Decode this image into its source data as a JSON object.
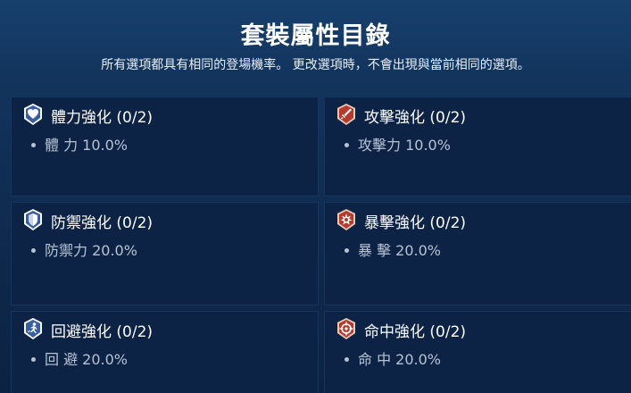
{
  "header": {
    "title": "套裝屬性目錄",
    "subtitle": "所有選項都具有相同的登場機率。 更改選項時，不會出現與當前相同的選項。"
  },
  "cards": [
    {
      "name": "體力強化 (0/2)",
      "stat": "體 力 10.0%",
      "icon": "heart-icon",
      "color": "#3a5f9e"
    },
    {
      "name": "攻擊強化 (0/2)",
      "stat": "攻擊力 10.0%",
      "icon": "sword-icon",
      "color": "#b23a2e"
    },
    {
      "name": "防禦強化 (0/2)",
      "stat": "防禦力 20.0%",
      "icon": "shield-icon",
      "color": "#3a5f9e"
    },
    {
      "name": "暴擊強化 (0/2)",
      "stat": "暴 擊 20.0%",
      "icon": "burst-icon",
      "color": "#b23a2e"
    },
    {
      "name": "回避強化 (0/2)",
      "stat": "回 避 20.0%",
      "icon": "dodge-icon",
      "color": "#3a5f9e"
    },
    {
      "name": "命中強化 (0/2)",
      "stat": "命 中 20.0%",
      "icon": "crosshair-icon",
      "color": "#b23a2e"
    }
  ]
}
